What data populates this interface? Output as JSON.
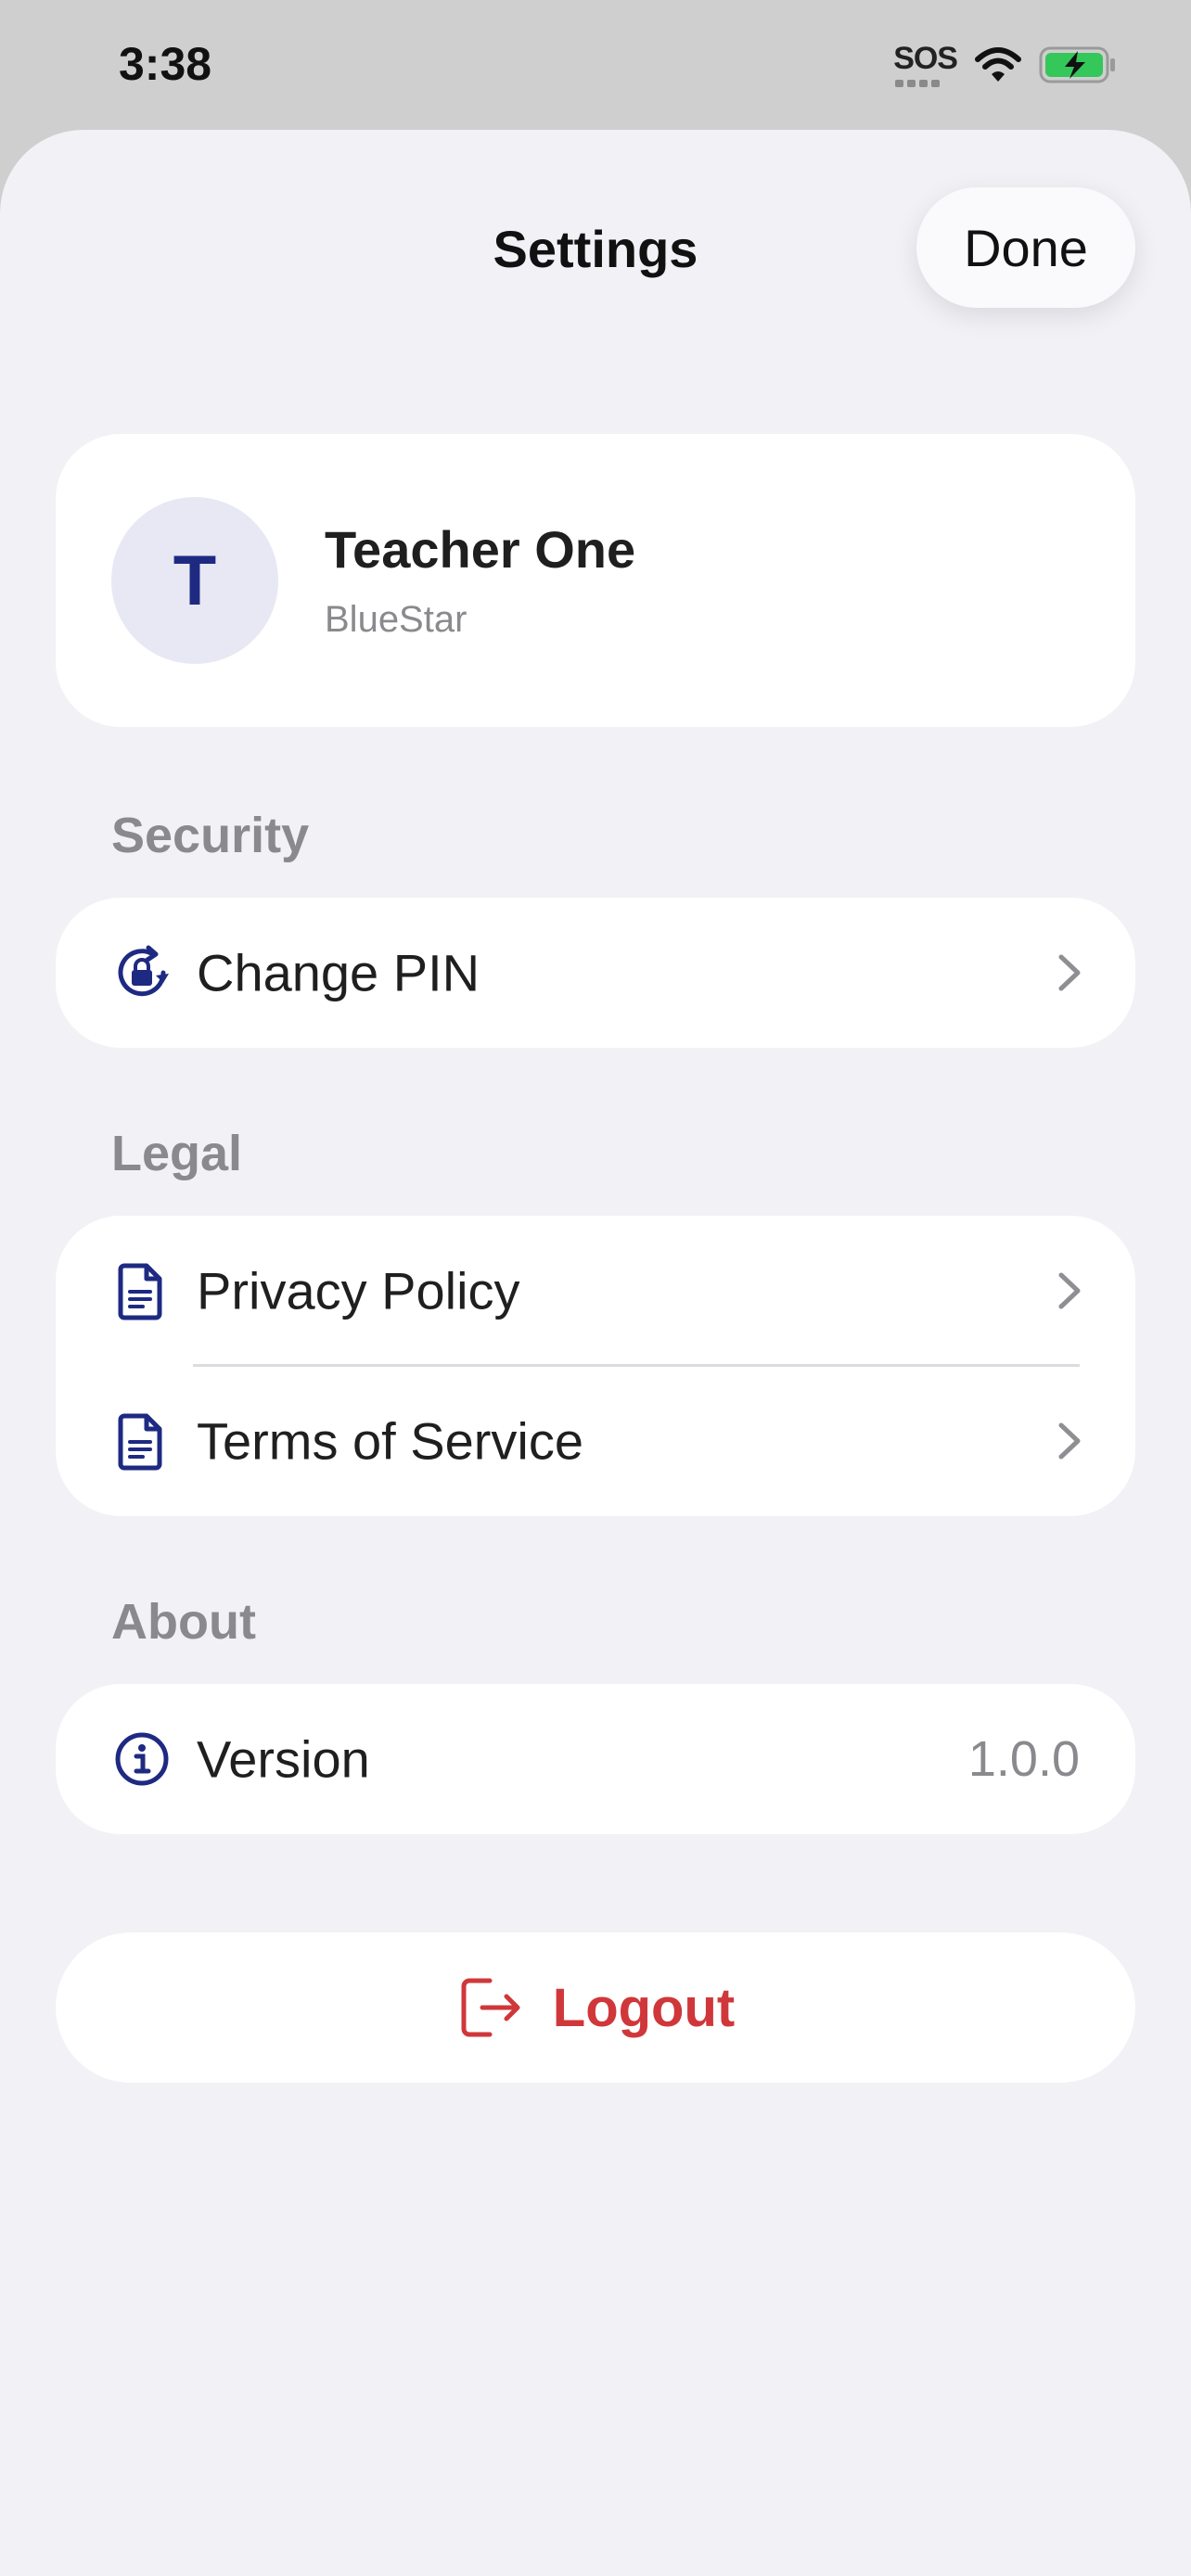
{
  "status_bar": {
    "time": "3:38",
    "sos": "SOS",
    "signal_icon": "wifi-icon",
    "battery_icon": "battery-charging-icon"
  },
  "header": {
    "title": "Settings",
    "done_label": "Done"
  },
  "profile": {
    "initial": "T",
    "name": "Teacher One",
    "organization": "BlueStar"
  },
  "sections": {
    "security": {
      "title": "Security",
      "items": [
        {
          "label": "Change PIN",
          "icon": "lock-rotation-icon"
        }
      ]
    },
    "legal": {
      "title": "Legal",
      "items": [
        {
          "label": "Privacy Policy",
          "icon": "document-icon"
        },
        {
          "label": "Terms of Service",
          "icon": "document-icon"
        }
      ]
    },
    "about": {
      "title": "About",
      "items": [
        {
          "label": "Version",
          "value": "1.0.0",
          "icon": "info-icon"
        }
      ]
    }
  },
  "logout": {
    "label": "Logout",
    "icon": "logout-icon"
  },
  "colors": {
    "accent": "#1e2a82",
    "danger": "#d0373a",
    "background": "#f1f1f6",
    "muted": "#8a8a8e"
  }
}
